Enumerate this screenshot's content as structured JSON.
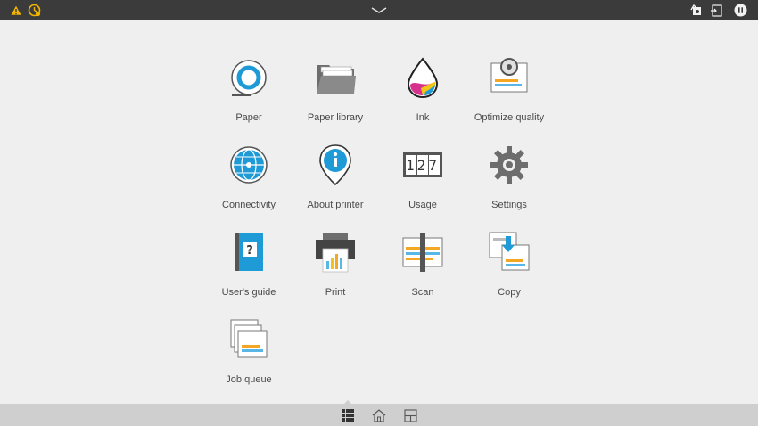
{
  "statusbar": {
    "icons": [
      "warning-printer-icon",
      "attention-clock-icon",
      "chevron-down-icon",
      "network-device-icon",
      "sign-in-icon",
      "pause-icon"
    ]
  },
  "apps": [
    {
      "label": "Paper",
      "icon": "paper-roll-icon"
    },
    {
      "label": "Paper library",
      "icon": "folder-icon"
    },
    {
      "label": "Ink",
      "icon": "ink-drop-icon"
    },
    {
      "label": "Optimize quality",
      "icon": "optimize-quality-icon"
    },
    {
      "label": "Connectivity",
      "icon": "globe-network-icon"
    },
    {
      "label": "About printer",
      "icon": "info-pin-icon"
    },
    {
      "label": "Usage",
      "icon": "counter-icon"
    },
    {
      "label": "Settings",
      "icon": "gear-icon"
    },
    {
      "label": "User's guide",
      "icon": "guide-book-icon"
    },
    {
      "label": "Print",
      "icon": "printer-icon"
    },
    {
      "label": "Scan",
      "icon": "scanner-icon"
    },
    {
      "label": "Copy",
      "icon": "copy-icon"
    },
    {
      "label": "Job queue",
      "icon": "job-queue-icon"
    }
  ],
  "usage_counter": "127",
  "bottom_nav": {
    "items": [
      "apps-grid-icon",
      "home-icon",
      "widgets-icon"
    ],
    "active": "apps-grid-icon"
  },
  "colors": {
    "topbar": "#3b3b3b",
    "background": "#efefef",
    "bottombar": "#cfcfcf",
    "accent_blue": "#1e9ad6",
    "warning_yellow": "#f0b400",
    "stripe_orange": "#f5a623",
    "stripe_blue": "#59b7e8"
  }
}
